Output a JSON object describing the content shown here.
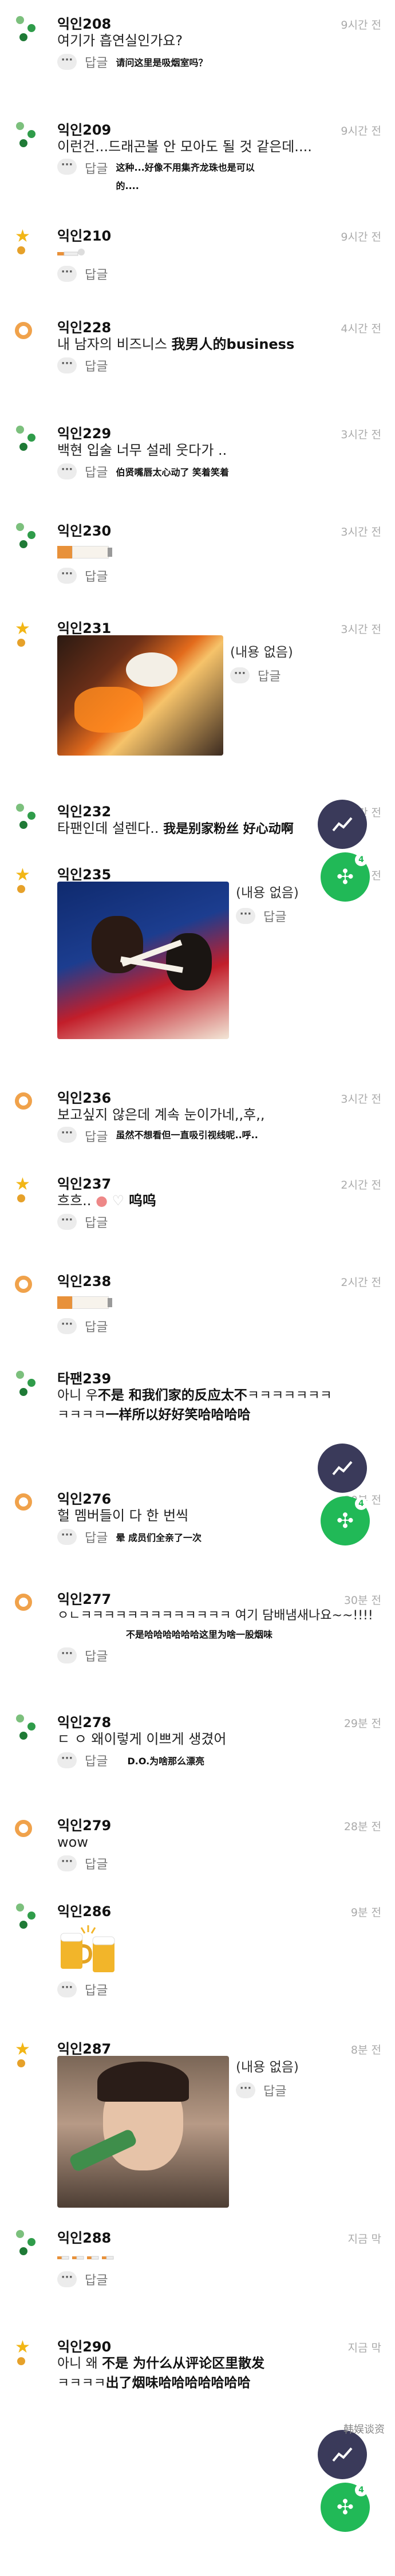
{
  "ui": {
    "reply_label": "답글",
    "more_label": "···",
    "empty_label": "(내용 없음)"
  },
  "comments": [
    {
      "user": "익인208",
      "time": "9시간 전",
      "text": "여기가 흡연실인가요?",
      "cn": "请问这里是吸烟室吗？"
    },
    {
      "user": "익인209",
      "time": "9시간 전",
      "text": "이런건...드래곤볼 안 모아도 될 것 같은데....",
      "cn": "这种...好像不用集齐龙珠也是可以的...."
    },
    {
      "user": "익인210",
      "time": "9시간 전",
      "text": ""
    },
    {
      "user": "익인228",
      "time": "4시간 전",
      "text": "내 남자의 비즈니스",
      "cn": "我男人的business"
    },
    {
      "user": "익인229",
      "time": "3시간 전",
      "text": "백현 입술 너무 설레 웃다가 ..",
      "cn": "伯贤嘴唇太心动了 笑着笑着"
    },
    {
      "user": "익인230",
      "time": "3시간 전",
      "text": ""
    },
    {
      "user": "익인231",
      "time": "3시간 전",
      "text": ""
    },
    {
      "user": "익인232",
      "time": "3시간 전",
      "text": "타팬인데 설렌다..",
      "cn": "我是别家粉丝 好心动啊"
    },
    {
      "user": "익인235",
      "time": "3시간 전",
      "text": ""
    },
    {
      "user": "익인236",
      "time": "3시간 전",
      "text": "보고싶지 않은데 계속 눈이가네,,후,,",
      "cn": "虽然不想看但一直吸引视线呢..呼.."
    },
    {
      "user": "익인237",
      "time": "2시간 전",
      "text": "흐흐..",
      "cn": "呜呜"
    },
    {
      "user": "익인238",
      "time": "2시간 전",
      "text": ""
    },
    {
      "user": "타팬239",
      "time": "",
      "text": "아니 우",
      "cn": "不是 和我们家的反应太不",
      "text2": "ㅋㅋㅋㅋㅋㅋㅋ",
      "text3": "ㅋㅋㅋㅋ",
      "cn2": "一样所以好好笑哈哈哈哈"
    },
    {
      "user": "익인276",
      "time": "30분 전",
      "text": "헐 멤버들이 다 한 번씩",
      "cn": "晕 成员们全亲了一次"
    },
    {
      "user": "익인277",
      "time": "30분 전",
      "text": "ㅇㄴㅋㅋㅋㅋㅋㅋㅋㅋㅋㅋㅋㅋㅋ 여기 담배냄새나요~~!!!!",
      "cn": "不是哈哈哈哈哈哈这里为啥一股烟味"
    },
    {
      "user": "익인278",
      "time": "29분 전",
      "text": "ㄷ ㅇ 왜이렇게 이쁘게 생겼어",
      "cn": "D.O.为啥那么漂亮"
    },
    {
      "user": "익인279",
      "time": "28분 전",
      "text": "wow"
    },
    {
      "user": "익인286",
      "time": "9분 전",
      "text": ""
    },
    {
      "user": "익인287",
      "time": "8분 전",
      "text": ""
    },
    {
      "user": "익인288",
      "time": "지금 막",
      "text": ""
    },
    {
      "user": "익인290",
      "time": "지금 막",
      "text": "아니 왜",
      "cn": "不是 为什么从评论区里散发",
      "text2": "ㅋㅋㅋㅋ",
      "cn2": "出了烟味哈哈哈哈哈哈哈"
    }
  ],
  "fab": {
    "badge": "4"
  },
  "watermark": "韩娱谈资"
}
